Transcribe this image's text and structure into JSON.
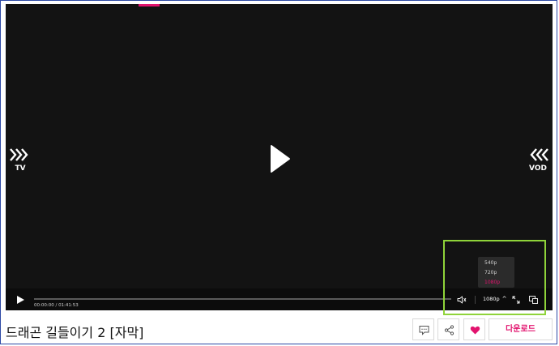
{
  "player": {
    "nav_left_label": "TV",
    "nav_right_label": "VOD",
    "time_current": "00:00:00",
    "time_separator": "/",
    "time_total": "01:41:53",
    "progress_fraction": 0,
    "quality": {
      "current": "1080p",
      "options": [
        "540p",
        "720p",
        "1080p"
      ],
      "selected_index": 2
    }
  },
  "title": "드래곤 길들이기 2 [자막]",
  "actions": {
    "download_label": "다운로드"
  },
  "colors": {
    "accent": "#e2136e",
    "player_bg": "#131313",
    "highlight": "#8fd33a"
  }
}
